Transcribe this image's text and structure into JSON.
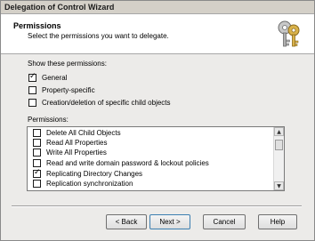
{
  "window": {
    "title": "Delegation of Control Wizard"
  },
  "header": {
    "title": "Permissions",
    "subtitle": "Select the permissions you want to delegate.",
    "icon": "keys-icon"
  },
  "show_permissions": {
    "label": "Show these permissions:",
    "options": [
      {
        "label": "General",
        "checked": true
      },
      {
        "label": "Property-specific",
        "checked": false
      },
      {
        "label": "Creation/deletion of specific child objects",
        "checked": false
      }
    ]
  },
  "permissions": {
    "label": "Permissions:",
    "items": [
      {
        "label": "Delete All Child Objects",
        "checked": false
      },
      {
        "label": "Read All Properties",
        "checked": false
      },
      {
        "label": "Write All Properties",
        "checked": false
      },
      {
        "label": "Read and write domain password & lockout policies",
        "checked": false
      },
      {
        "label": "Replicating Directory Changes",
        "checked": true
      },
      {
        "label": "Replication synchronization",
        "checked": false
      }
    ]
  },
  "buttons": {
    "back": "< Back",
    "next": "Next >",
    "cancel": "Cancel",
    "help": "Help"
  }
}
